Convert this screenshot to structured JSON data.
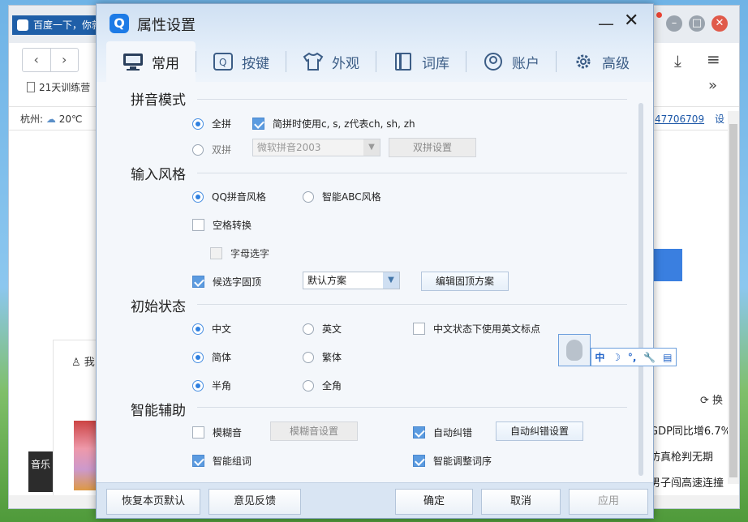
{
  "browser": {
    "tab_title": "百度一下，你就",
    "nav_back": "‹",
    "nav_forward": "›",
    "bookmark": "21天训练营",
    "weather_city": "杭州:",
    "weather_temp": "20℃",
    "header_number": "47706709",
    "header_set": "设",
    "more": "»",
    "me_label": "我",
    "music_label": "音乐",
    "refresh_label": "换",
    "news": [
      "GDP同比增6.7%",
      "仿真枪判无期",
      "男子闯高速连撞"
    ]
  },
  "dialog": {
    "title": "属性设置",
    "logo": "Q",
    "minimize": "—",
    "close": "✕",
    "tabs": [
      {
        "label": "常用",
        "icon": "monitor-icon"
      },
      {
        "label": "按键",
        "icon": "key-icon"
      },
      {
        "label": "外观",
        "icon": "shirt-icon"
      },
      {
        "label": "词库",
        "icon": "book-icon"
      },
      {
        "label": "账户",
        "icon": "user-icon"
      },
      {
        "label": "高级",
        "icon": "gear-icon"
      }
    ],
    "sections": {
      "pinyin_mode": "拼音模式",
      "input_style": "输入风格",
      "initial_state": "初始状态",
      "smart_assist": "智能辅助"
    },
    "pinyin": {
      "quanpin": "全拼",
      "jianpin": "简拼时使用c, s, z代表ch, sh, zh",
      "shuangpin": "双拼",
      "shuangpin_scheme": "微软拼音2003",
      "shuangpin_settings": "双拼设置"
    },
    "style": {
      "qq_style": "QQ拼音风格",
      "abc_style": "智能ABC风格",
      "space_convert": "空格转换",
      "letter_select": "字母选字",
      "fixed_candidates": "候选字固顶",
      "scheme": "默认方案",
      "edit_scheme": "编辑固顶方案"
    },
    "state": {
      "chinese": "中文",
      "english": "英文",
      "en_punct": "中文状态下使用英文标点",
      "simplified": "简体",
      "traditional": "繁体",
      "half_width": "半角",
      "full_width": "全角"
    },
    "assist": {
      "fuzzy": "模糊音",
      "fuzzy_settings": "模糊音设置",
      "auto_correct": "自动纠错",
      "auto_correct_settings": "自动纠错设置",
      "smart_words": "智能组词",
      "smart_order": "智能调整词序"
    },
    "footer": {
      "restore": "恢复本页默认",
      "feedback": "意见反馈",
      "ok": "确定",
      "cancel": "取消",
      "apply": "应用"
    }
  },
  "ime_bar": {
    "lang": "中",
    "moon": "☽",
    "punct": "°,",
    "tool": "🔧",
    "clip": "▤"
  }
}
